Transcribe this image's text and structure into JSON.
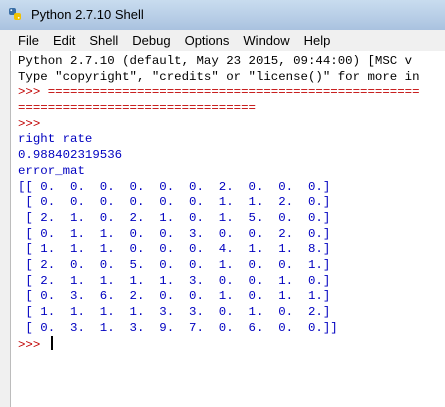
{
  "window": {
    "title": "Python 2.7.10 Shell"
  },
  "menu": [
    "File",
    "Edit",
    "Shell",
    "Debug",
    "Options",
    "Window",
    "Help"
  ],
  "shell": {
    "lines": [
      {
        "text": "Python 2.7.10 (default, May 23 2015, 09:44:00) [MSC v",
        "style": "std"
      },
      {
        "text": "Type \"copyright\", \"credits\" or \"license()\" for more in",
        "style": "std"
      },
      {
        "text": ">>> ==================================================",
        "style": "prompt"
      },
      {
        "text": "================================",
        "style": "prompt"
      },
      {
        "text": ">>> ",
        "style": "prompt"
      },
      {
        "text": "right rate",
        "style": "out"
      },
      {
        "text": "0.988402319536",
        "style": "out"
      },
      {
        "text": "error_mat",
        "style": "out"
      },
      {
        "text": "[[ 0.  0.  0.  0.  0.  0.  2.  0.  0.  0.]",
        "style": "out"
      },
      {
        "text": " [ 0.  0.  0.  0.  0.  0.  1.  1.  2.  0.]",
        "style": "out"
      },
      {
        "text": " [ 2.  1.  0.  2.  1.  0.  1.  5.  0.  0.]",
        "style": "out"
      },
      {
        "text": " [ 0.  1.  1.  0.  0.  3.  0.  0.  2.  0.]",
        "style": "out"
      },
      {
        "text": " [ 1.  1.  1.  0.  0.  0.  4.  1.  1.  8.]",
        "style": "out"
      },
      {
        "text": " [ 2.  0.  0.  5.  0.  0.  1.  0.  0.  1.]",
        "style": "out"
      },
      {
        "text": " [ 2.  1.  1.  1.  1.  3.  0.  0.  1.  0.]",
        "style": "out"
      },
      {
        "text": " [ 0.  3.  6.  2.  0.  0.  1.  0.  1.  1.]",
        "style": "out"
      },
      {
        "text": " [ 1.  1.  1.  1.  3.  3.  0.  1.  0.  2.]",
        "style": "out"
      },
      {
        "text": " [ 0.  3.  1.  3.  9.  7.  0.  6.  0.  0.]]",
        "style": "out"
      },
      {
        "text": ">>> ",
        "style": "prompt",
        "cursor": true
      }
    ]
  }
}
